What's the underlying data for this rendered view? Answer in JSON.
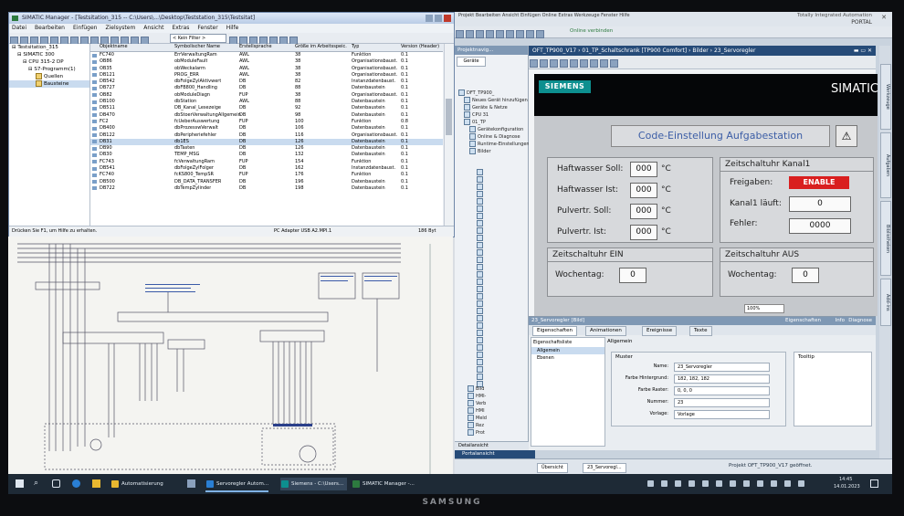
{
  "simatic_manager": {
    "title": "SIMATIC Manager - [Testsitation_315 -- C:\\Users\\...\\Desktop\\Teststation_315\\Testsitat]",
    "menu": [
      "Datei",
      "Bearbeiten",
      "Einfügen",
      "Zielsystem",
      "Ansicht",
      "Extras",
      "Fenster",
      "Hilfe"
    ],
    "filter": "< Kein Filter >",
    "tree": [
      "Testsitation_315",
      "SIMATIC 300",
      "CPU 315-2 DP",
      "S7-Programm(1)",
      "Quellen",
      "Bausteine"
    ],
    "columns": [
      "Objektname",
      "Symbolischer Name",
      "Erstellsprache",
      "Größe im Arbeitsspeic.",
      "Typ",
      "Version (Header)"
    ],
    "rows": [
      [
        "FC740",
        "ErrVerwaltungRam",
        "AWL",
        "38",
        "Funktion",
        "0.1"
      ],
      [
        "OB86",
        "obModuleFault",
        "AWL",
        "38",
        "Organisationsbaust.",
        "0.1"
      ],
      [
        "OB35",
        "obWeckalarm",
        "AWL",
        "38",
        "Organisationsbaust.",
        "0.1"
      ],
      [
        "DB121",
        "PROG_ERR",
        "AWL",
        "38",
        "Organisationsbaust.",
        "0.1"
      ],
      [
        "DB542",
        "dbFolgeZylAktivwert",
        "DB",
        "82",
        "Instanzdatenbaust.",
        "0.1"
      ],
      [
        "DB727",
        "dbFB800_Handling",
        "DB",
        "88",
        "Datenbaustein",
        "0.1"
      ],
      [
        "OB82",
        "obModuleDiagn",
        "FUP",
        "38",
        "Organisationsbaust.",
        "0.1"
      ],
      [
        "DB100",
        "dbStation",
        "AWL",
        "88",
        "Datenbaustein",
        "0.1"
      ],
      [
        "DB511",
        "DB_Kanal_Lesezeige",
        "DB",
        "92",
        "Datenbaustein",
        "0.1"
      ],
      [
        "DB470",
        "dbStoerVerwaltungAllgemein",
        "DB",
        "98",
        "Datenbaustein",
        "0.1"
      ],
      [
        "FC2",
        "fcUeberAuswertung",
        "FUP",
        "100",
        "Funktion",
        "0.8"
      ],
      [
        "DB400",
        "dbProzesswVerwalt",
        "DB",
        "106",
        "Datenbaustein",
        "0.1"
      ],
      [
        "DB122",
        "dbPeripheriefehler",
        "DB",
        "116",
        "Organisationsbaust.",
        "0.1"
      ],
      [
        "DB31",
        "db1ES",
        "DB",
        "126",
        "Datenbaustein",
        "0.1"
      ],
      [
        "DB90",
        "dbTasten",
        "DB",
        "126",
        "Datenbaustein",
        "0.1"
      ],
      [
        "DB30",
        "TEMP_MSG",
        "DB",
        "132",
        "Datenbaustein",
        "0.1"
      ],
      [
        "FC743",
        "fcVerwaltungRam",
        "FUP",
        "154",
        "Funktion",
        "0.1"
      ],
      [
        "DB541",
        "dbFolgeZylFolger",
        "DB",
        "162",
        "Instanzdatenbaust.",
        "0.1"
      ],
      [
        "FC740",
        "fcKS800_TempSR",
        "FUP",
        "176",
        "Funktion",
        "0.1"
      ],
      [
        "DB500",
        "DB_DATA_TRANSFER",
        "DB",
        "196",
        "Datenbaustein",
        "0.1"
      ],
      [
        "DB722",
        "dbTempZylinder",
        "DB",
        "198",
        "Datenbaustein",
        "0.1"
      ]
    ],
    "status_left": "Drücken Sie F1, um Hilfe zu erhalten.",
    "status_mid": "PC Adapter USB A2.MPI.1",
    "status_right": "186 Byt"
  },
  "tia": {
    "title_left": "Projekt  Bearbeiten  Ansicht  Einfügen  Online  Extras  Werkzeuge  Fenster  Hilfe",
    "brand1": "Totally Integrated Automation",
    "brand2": "PORTAL",
    "online_label": "Online verbinden",
    "project_nav": "Projektnavig...",
    "devices_tab": "Geräte",
    "nav_items": [
      "DFT_TP900_",
      "Neues Gerät hinzufügen",
      "Geräte & Netze",
      "CPU 31",
      "01_TP",
      "Gerätekonfiguration",
      "Online & Diagnose",
      "Runtime-Einstellungen",
      "Bilder"
    ],
    "nav_bottom": [
      "Bild",
      "HMI-",
      "Verb",
      "HMI",
      "Meld",
      "Rez",
      "Prot"
    ],
    "details": "Detailansicht",
    "portal": "Portalansicht",
    "breadcrumb": "OFT_TP900_V17 › 01_TP_Schaltschrank [TP900 Comfort] › Bilder › 23_Servoregler",
    "vtabs_right": [
      "Werkzeuge",
      "Aufgaben",
      "Bibliotheken",
      "Add-ins"
    ],
    "hmi": {
      "siemens": "SIEMENS",
      "simatic": "SIMATIC",
      "header": "Code-Einstellung Aufgabestation",
      "left_rows": [
        {
          "label": "Haftwasser Soll:",
          "value": "000",
          "unit": "°C"
        },
        {
          "label": "Haftwasser Ist:",
          "value": "000",
          "unit": "°C"
        },
        {
          "label": "Pulvertr. Soll:",
          "value": "000",
          "unit": "°C"
        },
        {
          "label": "Pulvertr. Ist:",
          "value": "000",
          "unit": "°C"
        }
      ],
      "kanal_title": "Zeitschaltuhr Kanal1",
      "freigaben_label": "Freigaben:",
      "enable_text": "ENABLE",
      "kanal_laeuft_label": "Kanal1 läuft:",
      "kanal_laeuft_value": "0",
      "fehler_label": "Fehler:",
      "fehler_value": "0000",
      "ein_title": "Zeitschaltuhr EIN",
      "aus_title": "Zeitschaltuhr AUS",
      "wochentag_label": "Wochentag:",
      "wochentag_ein": "0",
      "wochentag_aus": "0",
      "zoom": "100%"
    },
    "props": {
      "title": "23_Servoregler [Bild]",
      "tabs": [
        "Eigenschaften",
        "Animationen",
        "Ereignisse",
        "Texte"
      ],
      "right_tabs": [
        "Eigenschaften",
        "Info",
        "Diagnose"
      ],
      "list": [
        "Eigenschaftsliste",
        "Allgemein",
        "Ebenen"
      ],
      "section": "Allgemein",
      "subsection": "Muster",
      "fields": [
        {
          "label": "Name:",
          "value": "23_Servoregler"
        },
        {
          "label": "Farbe Hintergrund:",
          "value": "182, 182, 182"
        },
        {
          "label": "Farbe Raster:",
          "value": "0, 0, 0"
        },
        {
          "label": "Nummer:",
          "value": "23"
        },
        {
          "label": "Vorlage:",
          "value": "Vorlage"
        }
      ],
      "tooltip_label": "Tooltip"
    },
    "bottom_tabs": [
      "Übersicht",
      "23_Servoregl..."
    ],
    "bottom_status": "Projekt OFT_TP900_V17 geöffnet."
  },
  "taskbar": {
    "items": [
      "Automatisierung",
      "Servoregler Autom...",
      "Siemens - C:\\Users...",
      "SIMATIC Manager -..."
    ],
    "time": "14:45",
    "date": "14.01.2023"
  },
  "monitor_brand": "SAMSUNG",
  "colors": {
    "tia_header": "#264b78",
    "siemens_teal": "#0d8f8f",
    "enable_red": "#d91f1f",
    "taskbar": "#1e2a36"
  }
}
